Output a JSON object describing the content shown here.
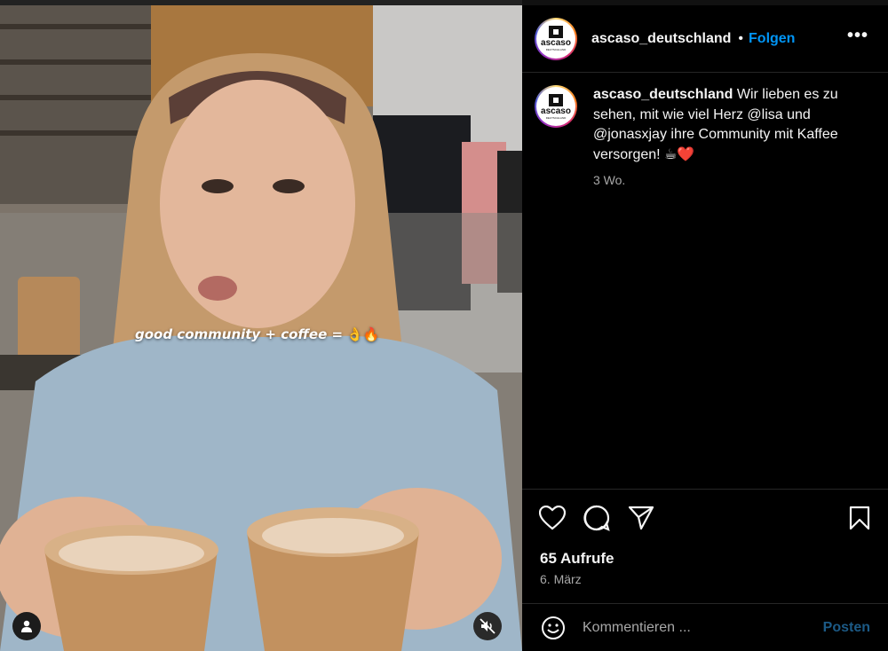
{
  "media": {
    "caption_text": "good community + coffee =",
    "caption_emoji": "👌🔥"
  },
  "header": {
    "avatar_logo": "ascaso",
    "avatar_logo_sub": "DEUTSCHLAND",
    "username": "ascaso_deutschland",
    "separator": "•",
    "follow_label": "Folgen",
    "more_label": "•••"
  },
  "caption": {
    "username": "ascaso_deutschland",
    "text": " Wir lieben es zu sehen, mit wie viel Herz @lisa und @jonasxjay ihre Community mit Kaffee versorgen! ☕❤️",
    "time": "3 Wo."
  },
  "stats": {
    "views": "65 Aufrufe",
    "date": "6. März"
  },
  "comment_bar": {
    "placeholder": "Kommentieren ...",
    "post_label": "Posten"
  },
  "icons": {
    "like": "heart-icon",
    "comment": "comment-icon",
    "share": "share-icon",
    "save": "bookmark-icon",
    "emoji": "smiley-icon",
    "user_tag": "person-icon",
    "mute": "speaker-muted-icon"
  },
  "colors": {
    "accent": "#0095f6",
    "background": "#000000",
    "secondary_text": "#a8a8a8",
    "post_disabled": "#1c5a86"
  }
}
